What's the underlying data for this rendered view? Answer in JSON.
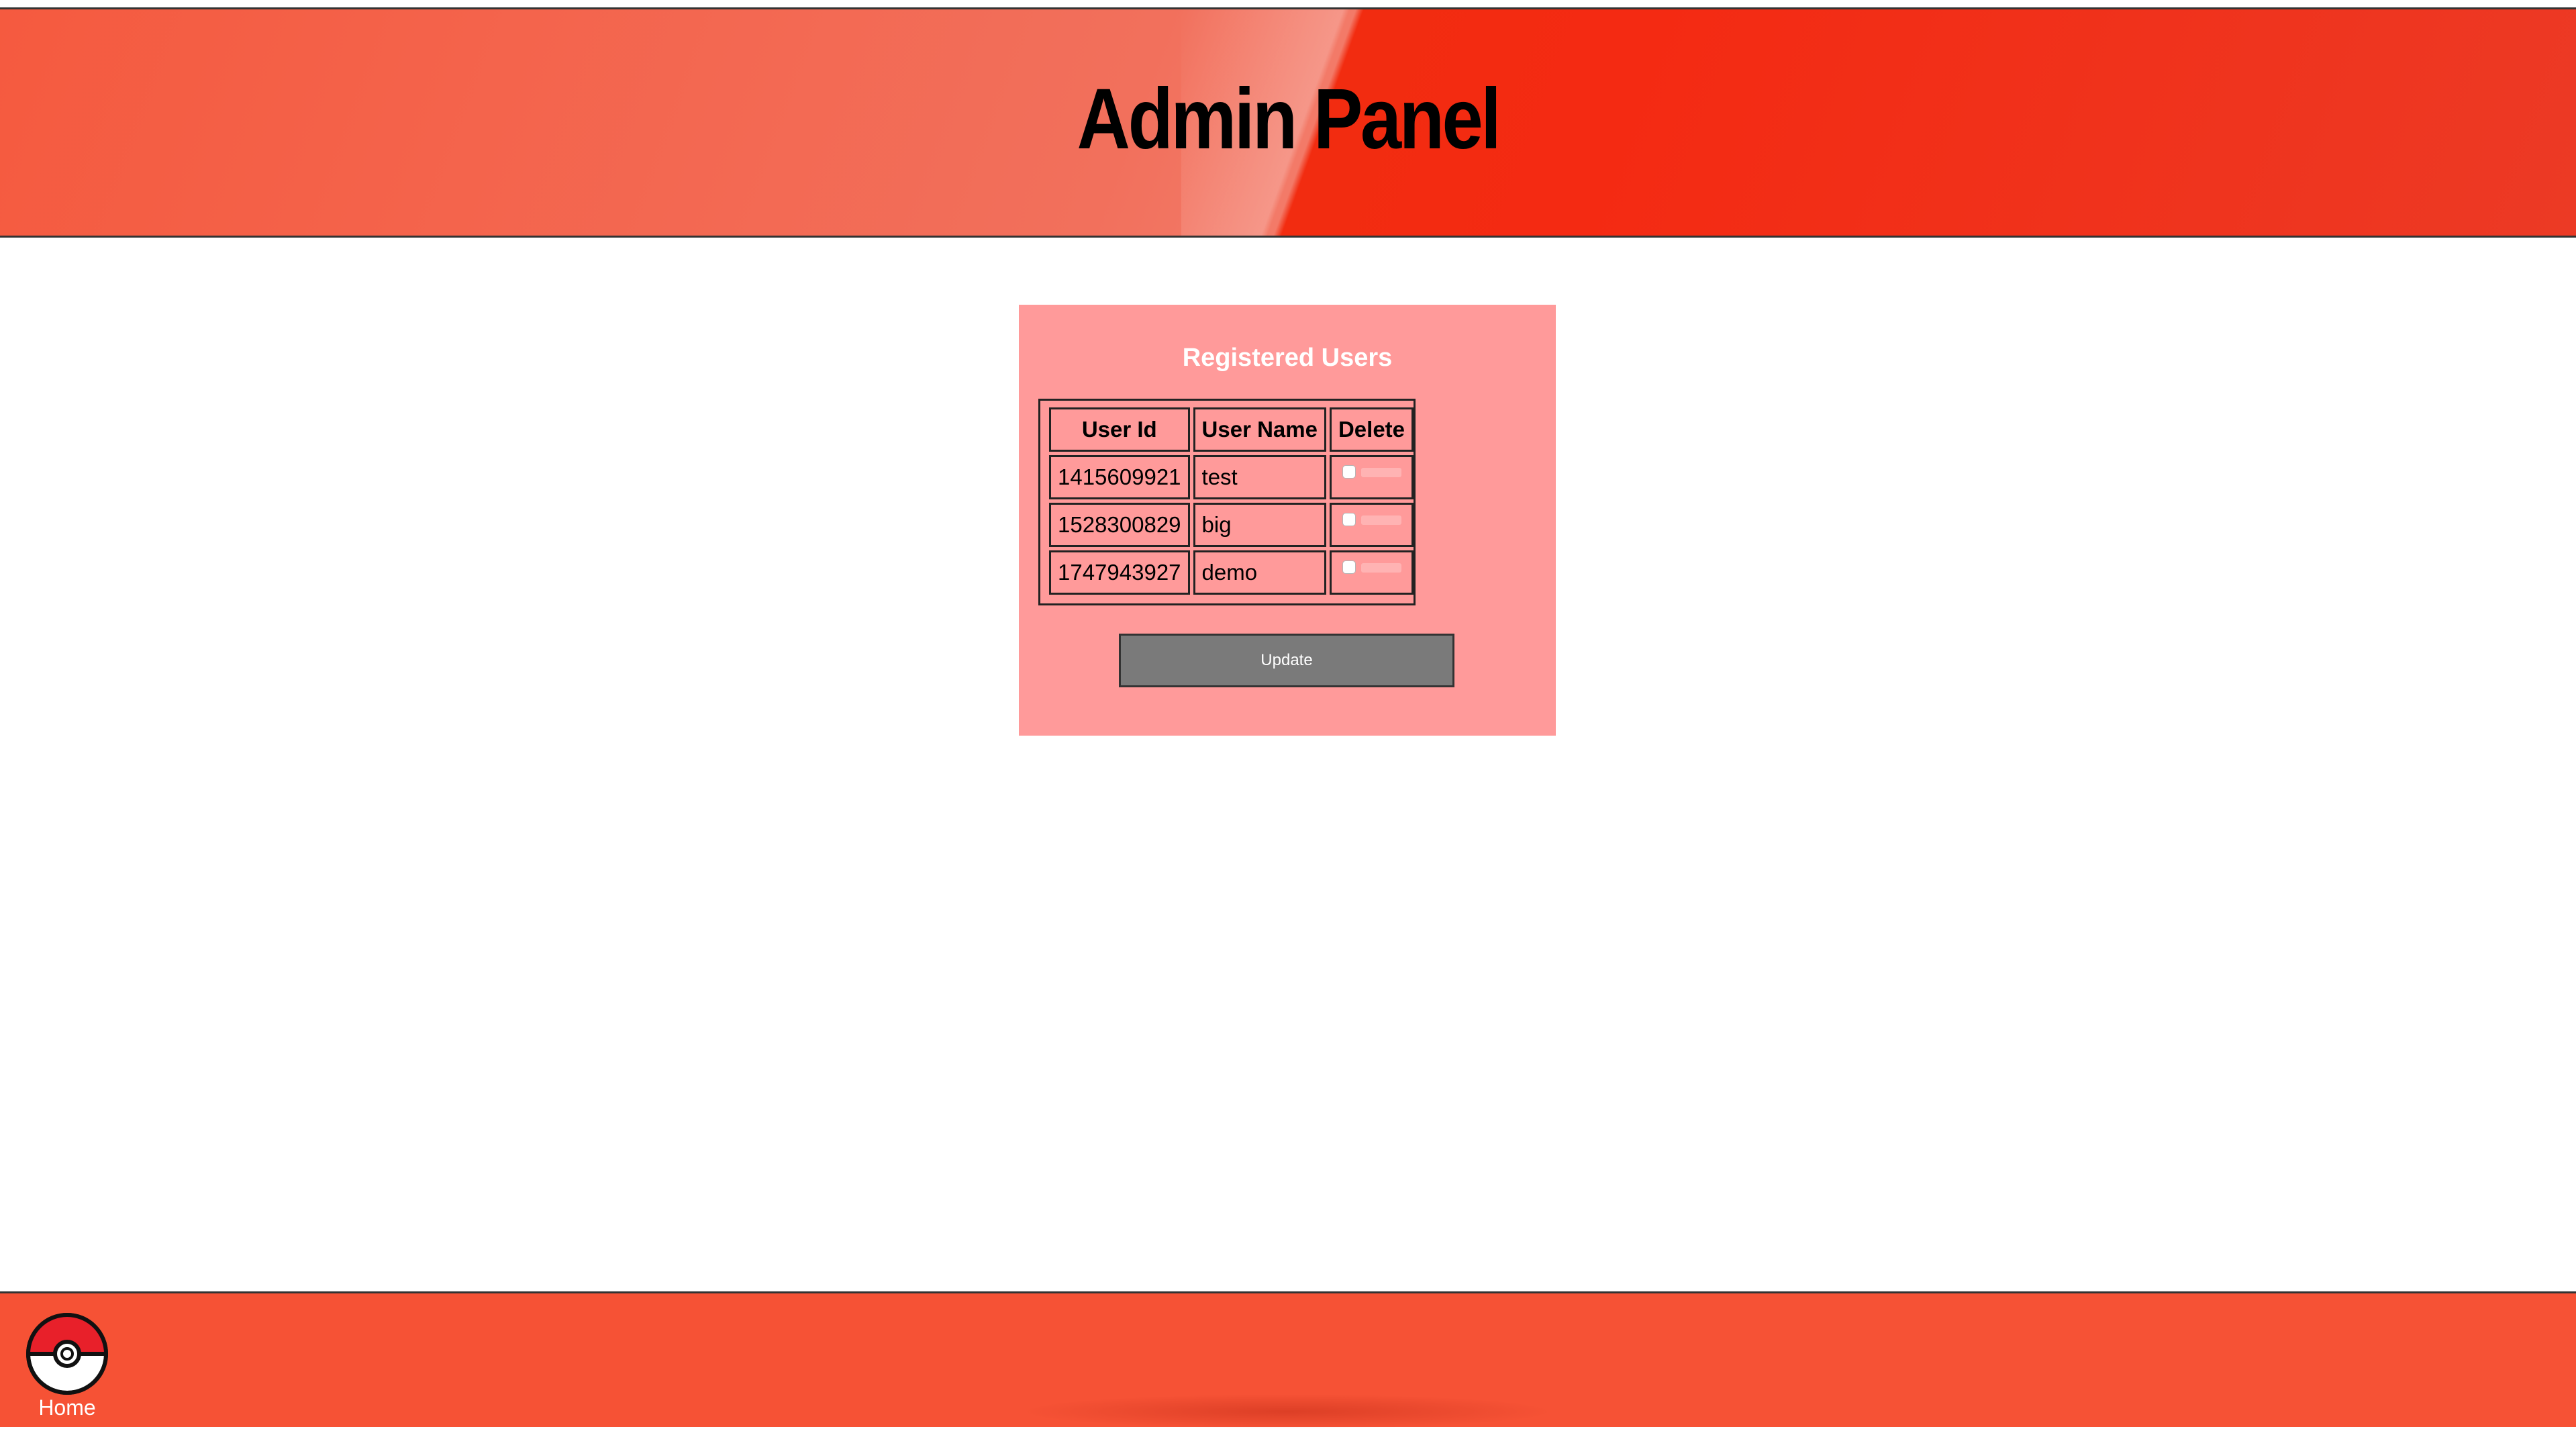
{
  "header": {
    "title": "Admin Panel"
  },
  "panel": {
    "title": "Registered Users",
    "columns": {
      "user_id": "User Id",
      "user_name": "User Name",
      "delete": "Delete"
    },
    "rows": [
      {
        "user_id": "1415609921",
        "user_name": "test",
        "delete_checked": false
      },
      {
        "user_id": "1528300829",
        "user_name": "big",
        "delete_checked": false
      },
      {
        "user_id": "1747943927",
        "user_name": "demo",
        "delete_checked": false
      }
    ],
    "update_label": "Update"
  },
  "footer": {
    "home_label": "Home"
  },
  "colors": {
    "header_red": "#f42a12",
    "panel_pink": "#ff9a9a",
    "footer_red": "#f65235",
    "button_gray": "#7a7a7a"
  }
}
